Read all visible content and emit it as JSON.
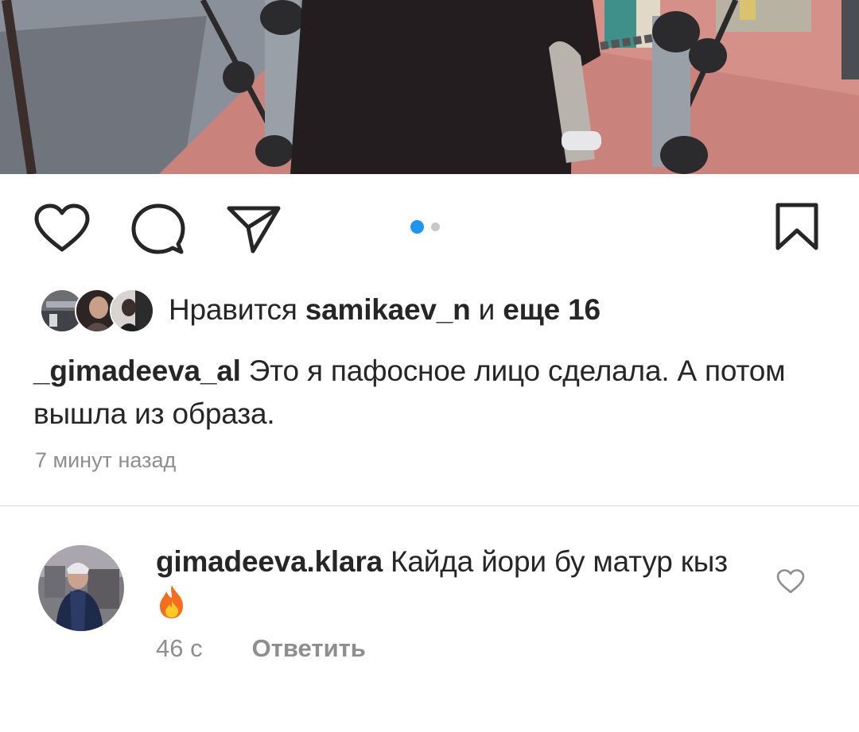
{
  "post": {
    "photo_icon": "post-photo",
    "carousel": {
      "count": 2,
      "active_index": 0
    },
    "actions": {
      "like_icon": "heart-icon",
      "comment_icon": "comment-bubble-icon",
      "share_icon": "paper-plane-icon",
      "save_icon": "bookmark-icon"
    },
    "likes": {
      "prefix": "Нравится ",
      "user": "samikaev_n",
      "middle": " и ",
      "others": "еще 16"
    },
    "caption": {
      "username": "_gimadeeva_al",
      "text": " Это я пафосное лицо сделала. А потом вышла из образа."
    },
    "timestamp": "7 минут назад"
  },
  "comment": {
    "username": "gimadeeva.klara",
    "text": " Кайда йори бу матур кыз",
    "emoji": "🔥",
    "emoji_icon": "fire-emoji-icon",
    "age": "46 с",
    "reply_label": "Ответить",
    "like_icon": "heart-outline-icon"
  },
  "colors": {
    "text": "#262626",
    "secondary": "#8e8e8e",
    "accent_dot": "#1e96f0",
    "divider": "#dbdbdb"
  }
}
